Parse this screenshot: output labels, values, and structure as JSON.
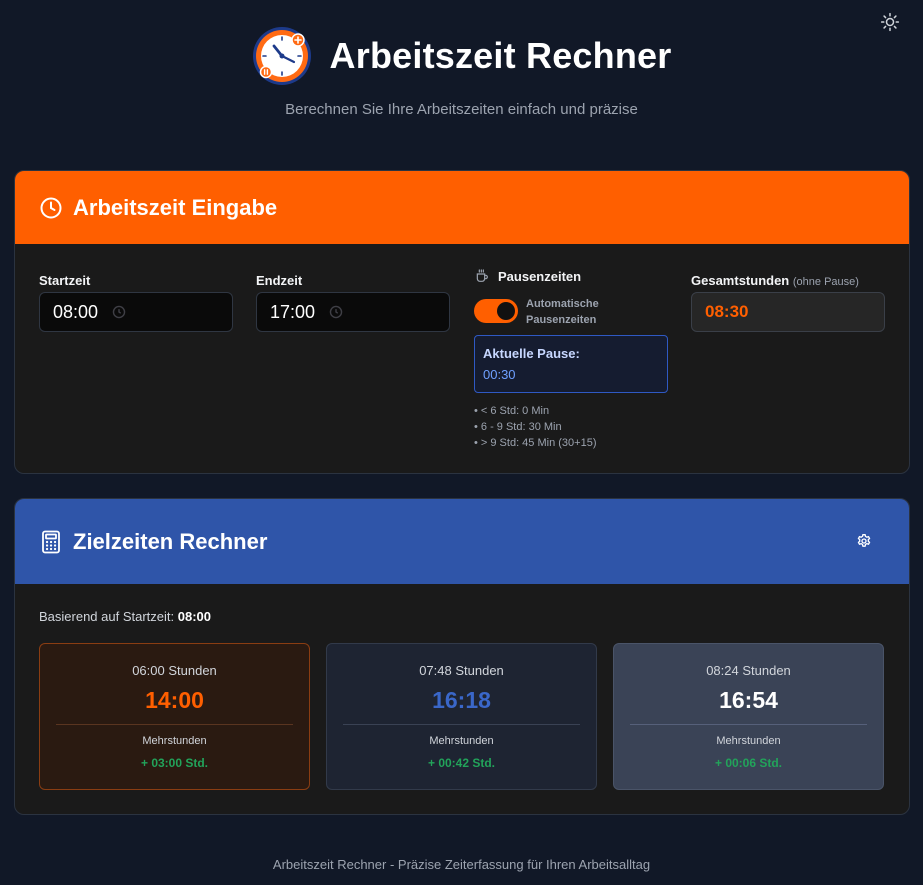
{
  "app": {
    "title": "Arbeitszeit Rechner",
    "subtitle": "Berechnen Sie Ihre Arbeitszeiten einfach und präzise"
  },
  "icons": {
    "theme_toggle": "sun-icon",
    "logo": "clock-logo-icon",
    "input_header": "clock-icon",
    "target_header": "calculator-icon",
    "settings": "gear-icon",
    "pause": "coffee-cup-icon",
    "time_field": "clock-icon"
  },
  "input_card": {
    "title": "Arbeitszeit Eingabe",
    "start_label": "Startzeit",
    "start_value": "08:00",
    "end_label": "Endzeit",
    "end_value": "17:00",
    "pause_title": "Pausenzeiten",
    "auto_pause_label": "Automatische Pausenzeiten",
    "auto_pause_on": true,
    "current_pause_label": "Aktuelle Pause:",
    "current_pause_value": "00:30",
    "rules": [
      "• < 6 Std: 0 Min",
      "• 6 - 9 Std: 30 Min",
      "• > 9 Std: 45 Min (30+15)"
    ],
    "total_label": "Gesamtstunden",
    "total_note": "(ohne Pause)",
    "total_value": "08:30"
  },
  "target_card": {
    "title": "Zielzeiten Rechner",
    "based_on_label": "Basierend auf Startzeit:",
    "based_on_value": "08:00",
    "targets": [
      {
        "label": "06:00 Stunden",
        "time": "14:00",
        "sub_label": "Mehrstunden",
        "extra": "+ 03:00 Std."
      },
      {
        "label": "07:48 Stunden",
        "time": "16:18",
        "sub_label": "Mehrstunden",
        "extra": "+ 00:42 Std."
      },
      {
        "label": "08:24 Stunden",
        "time": "16:54",
        "sub_label": "Mehrstunden",
        "extra": "+ 00:06 Std."
      }
    ]
  },
  "footer": {
    "text": "Arbeitszeit Rechner - Präzise Zeiterfassung für Ihren Arbeitsalltag"
  },
  "colors": {
    "background": "#111827",
    "accent_orange": "#ff5f00",
    "accent_blue": "#2f55a9",
    "success_green": "#22a35a"
  }
}
